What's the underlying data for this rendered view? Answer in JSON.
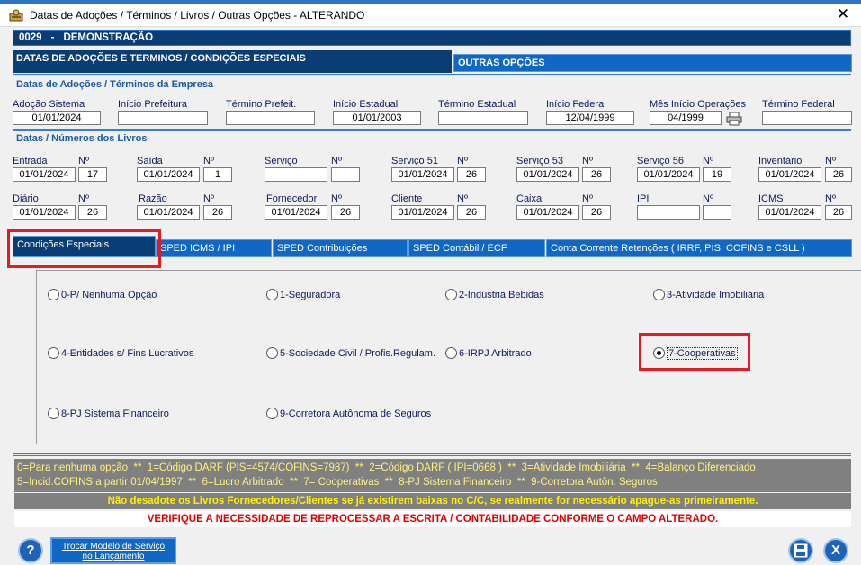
{
  "window": {
    "title": "Datas de Adoções / Términos / Livros / Outras Opções   -   ALTERANDO",
    "close_glyph": "✕"
  },
  "company": {
    "code": "0029",
    "dash": "-",
    "name": "DEMONSTRAÇÃO"
  },
  "main_tabs": {
    "active": "DATAS DE ADOÇÕES E TERMINOS / CONDIÇÕES ESPECIAIS",
    "other": "OUTRAS OPÇÕES"
  },
  "section_adoption": {
    "title": "Datas de Adoções / Términos da Empresa",
    "fields": [
      {
        "label": "Adoção Sistema",
        "value": "01/01/2024"
      },
      {
        "label": "Início Prefeitura",
        "value": ""
      },
      {
        "label": "Término Prefeit.",
        "value": ""
      },
      {
        "label": "Início Estadual",
        "value": "01/01/2003"
      },
      {
        "label": "Término Estadual",
        "value": ""
      },
      {
        "label": "Início Federal",
        "value": "12/04/1999"
      },
      {
        "label": "Mês Início Operações",
        "value": "04/1999"
      },
      {
        "label": "Término Federal",
        "value": ""
      }
    ]
  },
  "section_books": {
    "title": "Datas / Números dos Livros",
    "num_label": "Nº",
    "row1": [
      {
        "label": "Entrada",
        "date": "01/01/2024",
        "num": "17"
      },
      {
        "label": "Saída",
        "date": "01/01/2024",
        "num": "1"
      },
      {
        "label": "Serviço",
        "date": "",
        "num": ""
      },
      {
        "label": "Serviço 51",
        "date": "01/01/2024",
        "num": "26"
      },
      {
        "label": "Serviço 53",
        "date": "01/01/2024",
        "num": "26"
      },
      {
        "label": "Serviço 56",
        "date": "01/01/2024",
        "num": "19"
      },
      {
        "label": "Inventário",
        "date": "01/01/2024",
        "num": "26"
      }
    ],
    "row2": [
      {
        "label": "Diário",
        "date": "01/01/2024",
        "num": "26"
      },
      {
        "label": "Razão",
        "date": "01/01/2024",
        "num": "26"
      },
      {
        "label": "Fornecedor",
        "date": "01/01/2024",
        "num": "26"
      },
      {
        "label": "Cliente",
        "date": "01/01/2024",
        "num": "26"
      },
      {
        "label": "Caixa",
        "date": "01/01/2024",
        "num": "26"
      },
      {
        "label": "IPI",
        "date": "",
        "num": ""
      },
      {
        "label": "ICMS",
        "date": "01/01/2024",
        "num": "26"
      }
    ]
  },
  "sub_tabs": [
    "Condições Especiais",
    "SPED ICMS / IPI",
    "SPED Contribuições",
    "SPED Contábil / ECF",
    "Conta Corrente Retenções ( IRRF, PIS, COFINS  e  CSLL )"
  ],
  "options": [
    {
      "label": "0-P/ Nenhuma Opção",
      "selected": false
    },
    {
      "label": "1-Seguradora",
      "selected": false
    },
    {
      "label": "2-Indústria Bebidas",
      "selected": false
    },
    {
      "label": "3-Atividade Imobiliária",
      "selected": false
    },
    {
      "label": "4-Entidades s/ Fins Lucrativos",
      "selected": false
    },
    {
      "label": "5-Sociedade Civil / Profis.Regulam.",
      "selected": false
    },
    {
      "label": "6-IRPJ Arbitrado",
      "selected": false
    },
    {
      "label": "7-Cooperativas",
      "selected": true
    },
    {
      "label": "8-PJ Sistema Financeiro",
      "selected": false
    },
    {
      "label": "9-Corretora Autônoma de Seguros",
      "selected": false
    }
  ],
  "legend": {
    "line1": "0=Para nenhuma opção  **  1=Código DARF (PIS=4574/COFINS=7987)  **  2=Código DARF ( IPI=0668 )  **  3=Atividade Imobiliária  **  4=Balanço Diferenciado",
    "line2": "5=Incid.COFINS a partir 01/04/1997  **  6=Lucro Arbitrado  **  7= Cooperativas  **  8-PJ Sistema Financeiro  **  9-Corretora Autôn. Seguros"
  },
  "warnings": {
    "books": "Não desadote os Livros Fornecedores/Clientes se já existirem baixas no C/C, se realmente for necessário apague-as primeiramente.",
    "reprocess": "VERIFIQUE A NECESSIDADE DE REPROCESSAR A ESCRITA / CONTABILIDADE CONFORME O CAMPO ALTERADO."
  },
  "bottom": {
    "help": "?",
    "service_line1": "Trocar Modelo de Serviço",
    "service_line2": "no Lançamento",
    "close": "X"
  },
  "colors": {
    "accent": "#0a3d74",
    "tab_blue": "#1067c4",
    "highlight": "#e01c24",
    "legend_bg": "#808080",
    "legend_text": "#fff080"
  }
}
